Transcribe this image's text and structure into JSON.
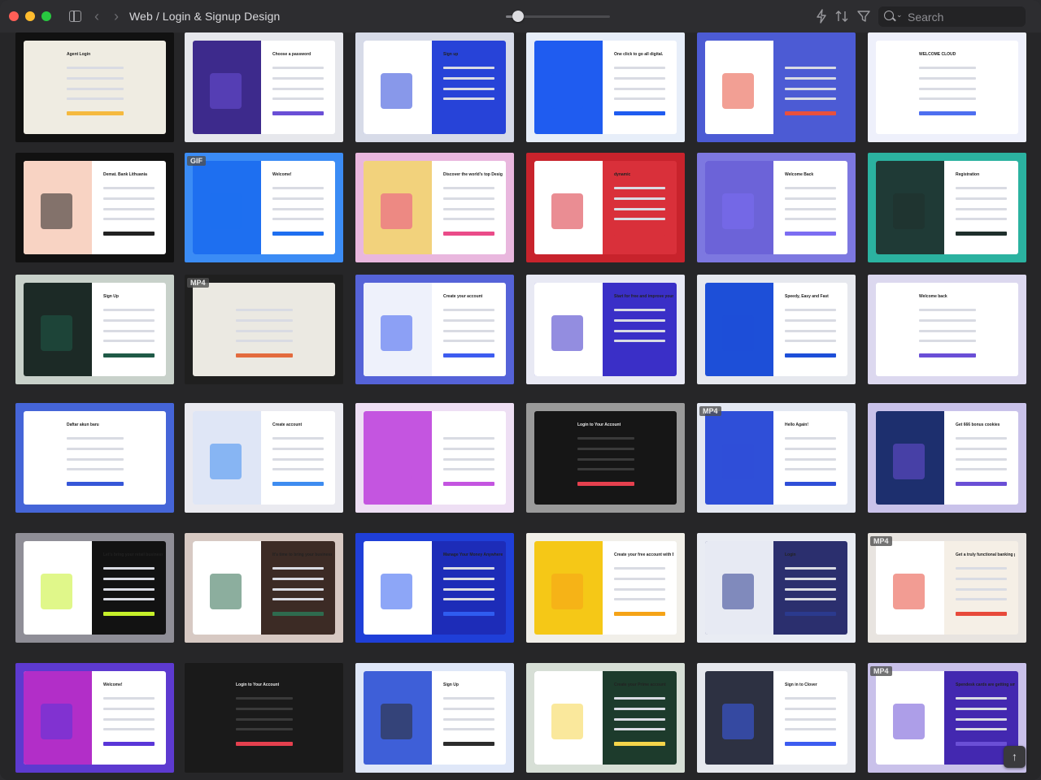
{
  "window": {
    "title": "Web / Login & Signup Design"
  },
  "toolbar": {
    "search_placeholder": "Search",
    "zoom_level": 0.12,
    "icons": [
      "bolt-icon",
      "sort-icon",
      "filter-icon",
      "search-icon"
    ]
  },
  "colors": {
    "titlebar": "#2d2d30",
    "background": "#262628"
  },
  "tiles": [
    {
      "row": 0,
      "col": 0,
      "title": "Agent Login",
      "bg": "#111111",
      "left_color": "#efece2",
      "right_color": "#efece2",
      "accent": "#f5b93f",
      "style": "light",
      "badge": ""
    },
    {
      "row": 0,
      "col": 1,
      "title": "Choose a password",
      "bg": "#e6e7ec",
      "left_color": "#3d2a8c",
      "right_color": "#ffffff",
      "accent": "#6a4fd6",
      "style": "split",
      "badge": ""
    },
    {
      "row": 0,
      "col": 2,
      "title": "Sign up",
      "bg": "#d7dbe8",
      "left_color": "#ffffff",
      "right_color": "#2743d8",
      "accent": "#2743d8",
      "style": "split",
      "badge": ""
    },
    {
      "row": 0,
      "col": 3,
      "title": "One click to go all digital.",
      "bg": "#e7eef9",
      "left_color": "#1f5cf0",
      "right_color": "#ffffff",
      "accent": "#1f5cf0",
      "style": "split",
      "badge": ""
    },
    {
      "row": 0,
      "col": 4,
      "title": "",
      "bg": "#4c5bd4",
      "left_color": "#ffffff",
      "right_color": "#4c5bd4",
      "accent": "#e8503d",
      "style": "split",
      "badge": ""
    },
    {
      "row": 0,
      "col": 5,
      "title": "WELCOME CLOUD",
      "bg": "#eef0fb",
      "left_color": "#ffffff",
      "right_color": "#ffffff",
      "accent": "#4e6ff0",
      "style": "light",
      "badge": ""
    },
    {
      "row": 1,
      "col": 0,
      "title": "Demat. Bank Lithuania",
      "bg": "#111111",
      "left_color": "#f8d3c3",
      "right_color": "#ffffff",
      "accent": "#222222",
      "style": "split",
      "badge": ""
    },
    {
      "row": 1,
      "col": 1,
      "title": "Welcome!",
      "bg": "#3b8cf5",
      "left_color": "#1e6ff0",
      "right_color": "#ffffff",
      "accent": "#1e6ff0",
      "style": "split",
      "badge": "GIF"
    },
    {
      "row": 1,
      "col": 2,
      "title": "Discover the world's top Designers & Creatives",
      "bg": "#e9b7de",
      "left_color": "#f2d27c",
      "right_color": "#ffffff",
      "accent": "#ea4c89",
      "style": "split",
      "badge": ""
    },
    {
      "row": 1,
      "col": 3,
      "title": "dynamic",
      "bg": "#c8232c",
      "left_color": "#ffffff",
      "right_color": "#d9303a",
      "accent": "#d9303a",
      "style": "split",
      "badge": ""
    },
    {
      "row": 1,
      "col": 4,
      "title": "Welcome Back",
      "bg": "#7d78e0",
      "left_color": "#6c63d8",
      "right_color": "#ffffff",
      "accent": "#7c6df2",
      "style": "split",
      "badge": ""
    },
    {
      "row": 1,
      "col": 5,
      "title": "Registration",
      "bg": "#2bb2a0",
      "left_color": "#1f3a36",
      "right_color": "#ffffff",
      "accent": "#1f2f2c",
      "style": "split",
      "badge": ""
    },
    {
      "row": 2,
      "col": 0,
      "title": "Sign Up",
      "bg": "#c8d1ca",
      "left_color": "#1c2a26",
      "right_color": "#ffffff",
      "accent": "#1f5a47",
      "style": "split",
      "badge": ""
    },
    {
      "row": 2,
      "col": 1,
      "title": "",
      "bg": "#1f1f1f",
      "left_color": "#ebe9e2",
      "right_color": "#ebe9e2",
      "accent": "#e36b3e",
      "style": "light",
      "badge": "MP4"
    },
    {
      "row": 2,
      "col": 2,
      "title": "Create your account",
      "bg": "#5563d8",
      "left_color": "#eef1fb",
      "right_color": "#ffffff",
      "accent": "#3d5cf0",
      "style": "split",
      "badge": ""
    },
    {
      "row": 2,
      "col": 3,
      "title": "Start for free and improve your speaker career just in one click.",
      "bg": "#e8e9f4",
      "left_color": "#ffffff",
      "right_color": "#3a2fc7",
      "accent": "#3a2fc7",
      "style": "split",
      "badge": ""
    },
    {
      "row": 2,
      "col": 4,
      "title": "Speedy, Easy and Fast",
      "bg": "#e6e8ee",
      "left_color": "#1d4fd8",
      "right_color": "#ffffff",
      "accent": "#1d4fd8",
      "style": "split",
      "badge": ""
    },
    {
      "row": 2,
      "col": 5,
      "title": "Welcome back",
      "bg": "#dcd8ef",
      "left_color": "#ffffff",
      "right_color": "#ffffff",
      "accent": "#6a4fd6",
      "style": "light",
      "badge": ""
    },
    {
      "row": 3,
      "col": 0,
      "title": "Daftar akun baru",
      "bg": "#4565d8",
      "left_color": "#ffffff",
      "right_color": "#ffffff",
      "accent": "#3657d8",
      "style": "light",
      "badge": ""
    },
    {
      "row": 3,
      "col": 1,
      "title": "Create account",
      "bg": "#eaeaf0",
      "left_color": "#dfe6f6",
      "right_color": "#ffffff",
      "accent": "#3e8cf0",
      "style": "split",
      "badge": ""
    },
    {
      "row": 3,
      "col": 2,
      "title": "",
      "bg": "#eedff4",
      "left_color": "#c455e0",
      "right_color": "#ffffff",
      "accent": "#c455e0",
      "style": "split",
      "badge": ""
    },
    {
      "row": 3,
      "col": 3,
      "title": "Login to Your Account",
      "bg": "#9a9a9a",
      "left_color": "#161616",
      "right_color": "#161616",
      "accent": "#e5404e",
      "style": "dark",
      "badge": ""
    },
    {
      "row": 3,
      "col": 4,
      "title": "Hello Again!",
      "bg": "#e4e8f2",
      "left_color": "#2f4fd8",
      "right_color": "#ffffff",
      "accent": "#2f4fd8",
      "style": "split",
      "badge": "MP4"
    },
    {
      "row": 3,
      "col": 5,
      "title": "Get 666 bonus cookies",
      "bg": "#c9c2ea",
      "left_color": "#1d2f6e",
      "right_color": "#ffffff",
      "accent": "#6a4fd6",
      "style": "split",
      "badge": ""
    },
    {
      "row": 4,
      "col": 0,
      "title": "Let's bring your retail business to eShop",
      "bg": "#8f8e97",
      "left_color": "#ffffff",
      "right_color": "#121212",
      "accent": "#c6f02a",
      "style": "split",
      "badge": ""
    },
    {
      "row": 4,
      "col": 1,
      "title": "It's time to bring your business online.",
      "bg": "#d7c9c3",
      "left_color": "#ffffff",
      "right_color": "#3c2b25",
      "accent": "#2e6b4e",
      "style": "split",
      "badge": ""
    },
    {
      "row": 4,
      "col": 2,
      "title": "Manage Your Money Anywhere",
      "bg": "#1f3fd8",
      "left_color": "#ffffff",
      "right_color": "#1d2cb8",
      "accent": "#2f5cf0",
      "style": "split",
      "badge": ""
    },
    {
      "row": 4,
      "col": 3,
      "title": "Create your free account with Bluepages",
      "bg": "#f1efe9",
      "left_color": "#f5c817",
      "right_color": "#ffffff",
      "accent": "#f5a317",
      "style": "split",
      "badge": ""
    },
    {
      "row": 4,
      "col": 4,
      "title": "Login",
      "bg": "#e9ecf3",
      "left_color": "#e7eaf3",
      "right_color": "#2b2f6e",
      "accent": "#2b3a8e",
      "style": "split",
      "badge": ""
    },
    {
      "row": 4,
      "col": 5,
      "title": "Get a truly functional banking platform",
      "bg": "#e8e4e0",
      "left_color": "#ffffff",
      "right_color": "#f5efe6",
      "accent": "#e74a3b",
      "style": "split",
      "badge": "MP4"
    },
    {
      "row": 5,
      "col": 0,
      "title": "Welcome!",
      "bg": "#5d3ad0",
      "left_color": "#b22ec8",
      "right_color": "#ffffff",
      "accent": "#5a36d8",
      "style": "split",
      "badge": ""
    },
    {
      "row": 5,
      "col": 1,
      "title": "Login to Your Account",
      "bg": "#1a1a1a",
      "left_color": "#1a1a1a",
      "right_color": "#262626",
      "accent": "#e5404e",
      "style": "dark",
      "badge": ""
    },
    {
      "row": 5,
      "col": 2,
      "title": "Sign Up",
      "bg": "#dfe7f8",
      "left_color": "#3e5fd8",
      "right_color": "#ffffff",
      "accent": "#2c2c2c",
      "style": "split",
      "badge": ""
    },
    {
      "row": 5,
      "col": 3,
      "title": "Create your Prime account",
      "bg": "#d7dfd6",
      "left_color": "#ffffff",
      "right_color": "#1d3b2c",
      "accent": "#f5d54a",
      "style": "split",
      "badge": ""
    },
    {
      "row": 5,
      "col": 4,
      "title": "Sign in to Clover",
      "bg": "#e6e8ee",
      "left_color": "#2d3142",
      "right_color": "#ffffff",
      "accent": "#3d5cf0",
      "style": "split",
      "badge": ""
    },
    {
      "row": 5,
      "col": 5,
      "title": "Spendesk cards are getting smarter",
      "bg": "#c9c1ea",
      "left_color": "#ffffff",
      "right_color": "#4328b0",
      "accent": "#6a4fd6",
      "style": "split",
      "badge": "MP4"
    }
  ]
}
